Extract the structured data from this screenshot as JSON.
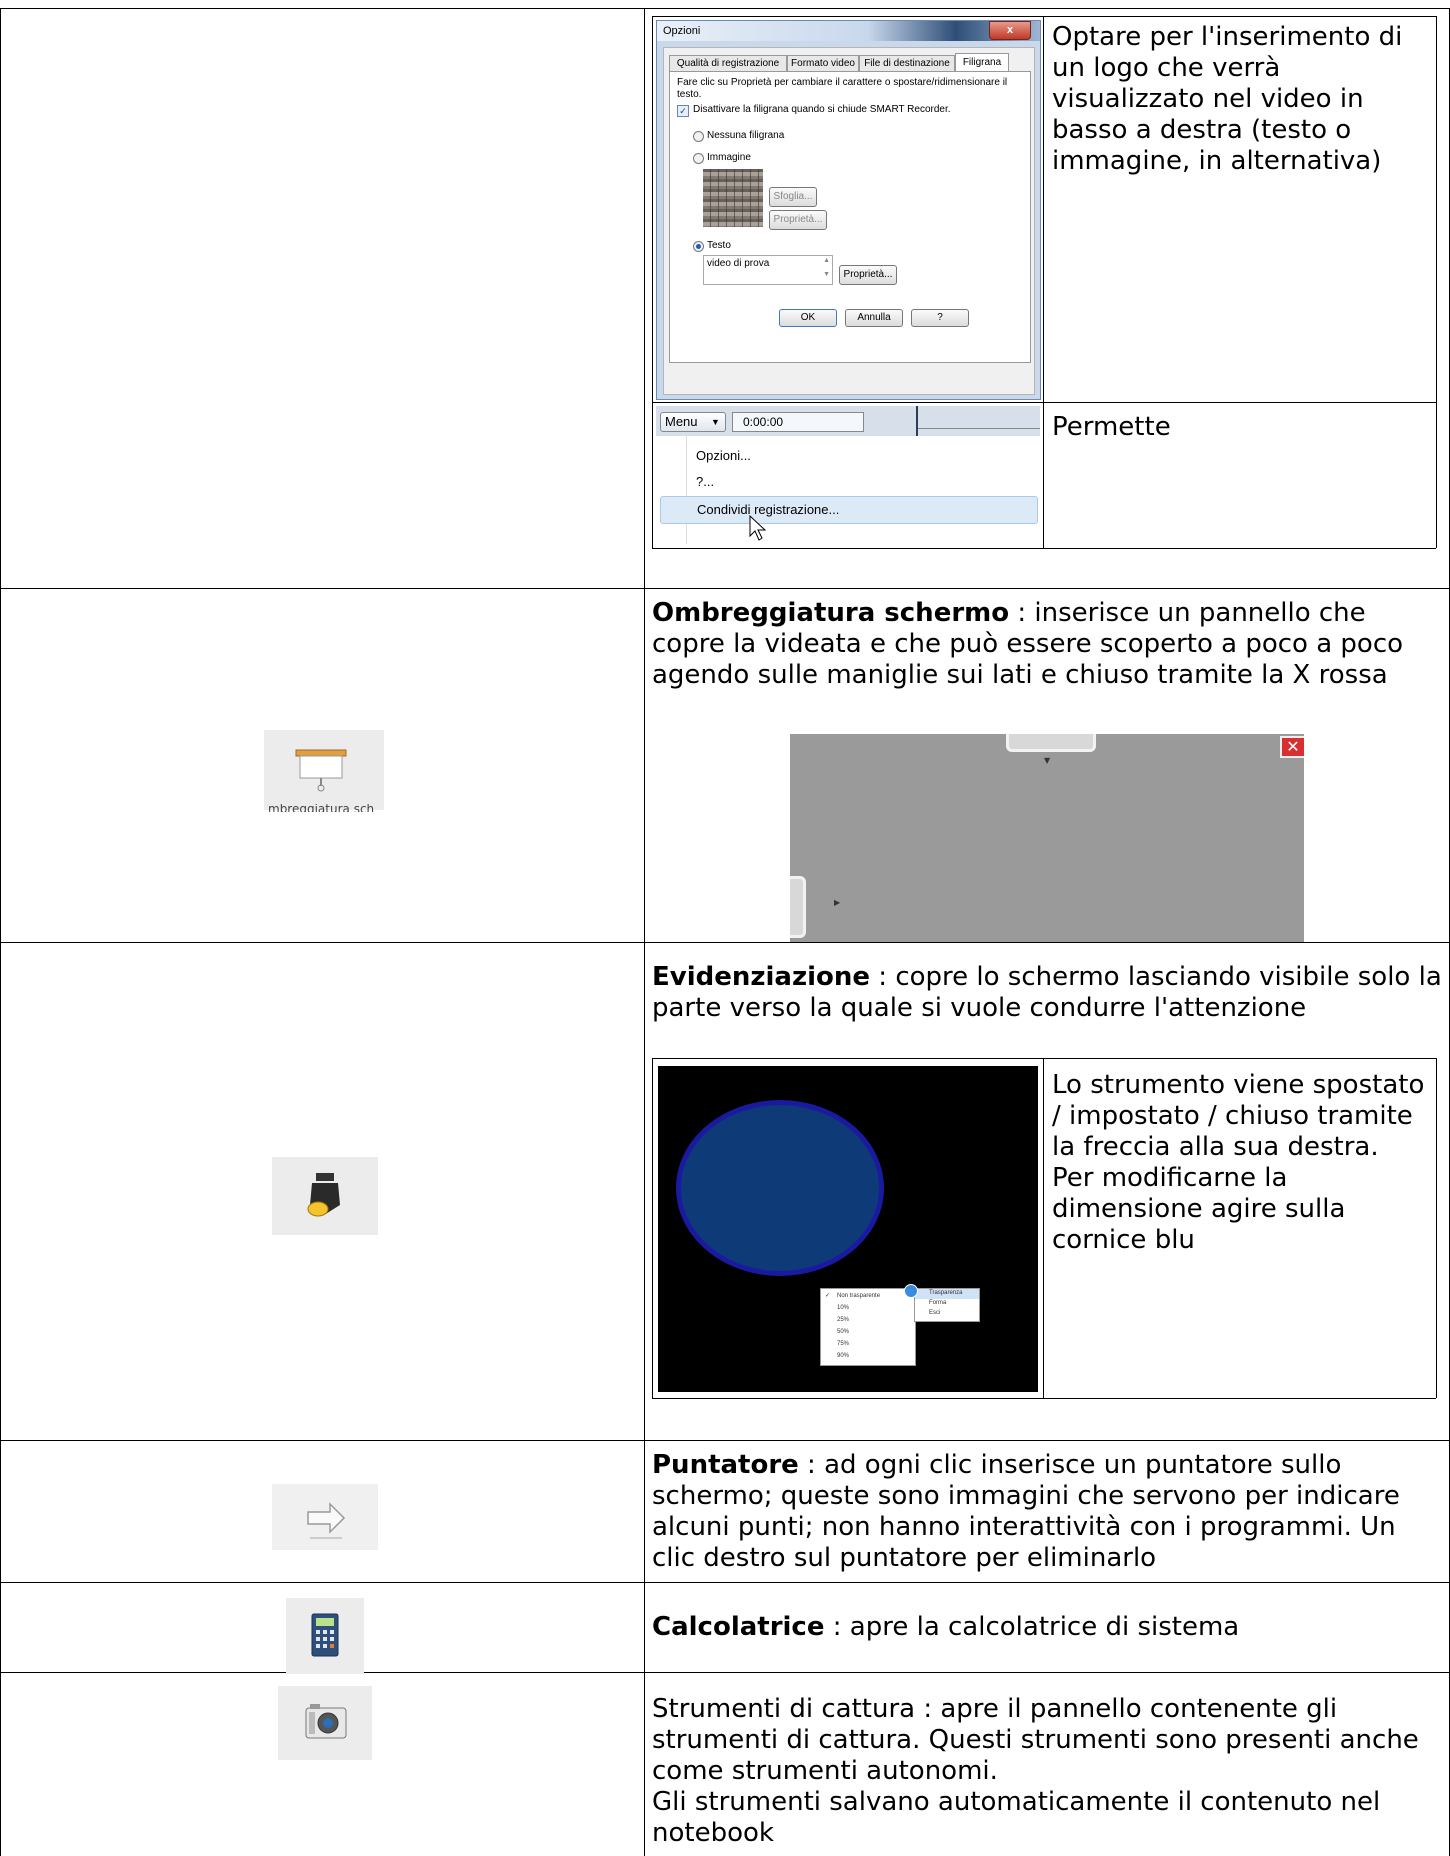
{
  "options_dialog": {
    "title": "Opzioni",
    "close_label": "x",
    "tabs": [
      "Qualità di registrazione",
      "Formato video",
      "File di destinazione",
      "Filigrana"
    ],
    "active_tab": "Filigrana",
    "instruction": "Fare clic su Proprietà per cambiare il carattere o spostare/ridimensionare il testo.",
    "checkbox_label": "Disattivare la filigrana quando si chiude SMART Recorder.",
    "radio_none": "Nessuna filigrana",
    "radio_image": "Immagine",
    "browse_button": "Sfoglia...",
    "image_properties_button": "Proprietà...",
    "radio_text": "Testo",
    "text_value": "video di prova",
    "text_properties_button": "Proprietà...",
    "ok_button": "OK",
    "cancel_button": "Annulla",
    "help_button": "?"
  },
  "watermark_description": "Optare per l'inserimento di un logo che verrà visualizzato nel video in basso a destra (testo o immagine, in alternativa)",
  "recorder_menu": {
    "menu_label": "Menu",
    "time": "0:00:00",
    "items": [
      "Opzioni...",
      "?...",
      "Condividi registrazione..."
    ]
  },
  "share_description": "Permette",
  "rows": {
    "screen_shade": {
      "icon_caption": "mbreggiatura sch",
      "title": "Ombreggiatura schermo",
      "text": " : inserisce un pannello che copre la videata e che può essere scoperto a poco a poco agendo sulle maniglie sui lati e chiuso tramite la X rossa"
    },
    "spotlight": {
      "title": "Evidenziazione",
      "text": " : copre lo schermo  lasciando visibile solo la parte verso la quale si vuole condurre l'attenzione",
      "side_text": "Lo strumento viene spostato / impostato / chiuso tramite la freccia alla sua destra.\nPer modificarne la dimensione agire sulla cornice blu",
      "transparency_options": [
        "Non trasparente",
        "10%",
        "25%",
        "50%",
        "75%",
        "90%"
      ],
      "context_menu": [
        "Trasparenza",
        "Forma",
        "Esci"
      ]
    },
    "pointer": {
      "title": "Puntatore",
      "text": " : ad ogni clic inserisce un puntatore sullo schermo; queste sono immagini che servono per indicare alcuni punti; non hanno interattività con i programmi. Un clic destro sul puntatore per eliminarlo"
    },
    "calculator": {
      "title": "Calcolatrice",
      "text": " : apre la calcolatrice di sistema"
    },
    "capture": {
      "text": "Strumenti di cattura : apre il pannello contenente gli strumenti di cattura. Questi strumenti sono presenti anche come strumenti autonomi.\nGli strumenti salvano automaticamente il contenuto nel notebook"
    }
  },
  "colors": {
    "shade_gray": "#9a9a9a",
    "spot_fill": "#0e3a78",
    "spot_border": "#1a1aa0",
    "close_red": "#d83030"
  }
}
